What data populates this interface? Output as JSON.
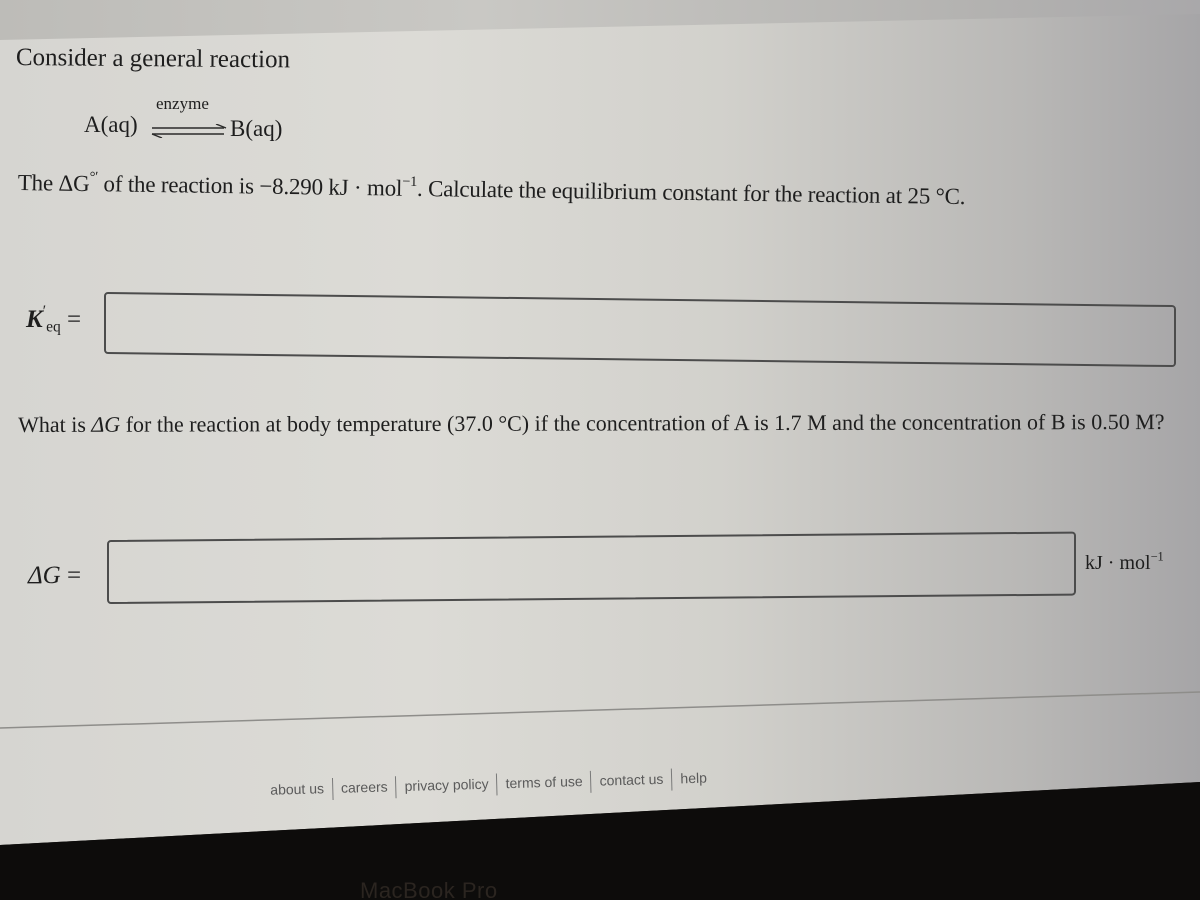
{
  "question": {
    "intro": "Consider a general reaction",
    "reaction": {
      "reactant": "A(aq)",
      "product": "B(aq)",
      "catalyst": "enzyme",
      "arrow": "equilibrium-arrow"
    },
    "part1": {
      "prompt_pre": "The ",
      "delta_g_symbol": "ΔG",
      "delta_g_super": "°′",
      "prompt_mid": " of the reaction is −8.290 kJ · mol",
      "exponent": "−1",
      "prompt_post": ". Calculate the equilibrium constant for the reaction at 25 °C.",
      "label_symbol": "K",
      "label_super": "′",
      "label_sub": "eq",
      "label_equals": " =",
      "answer_value": "",
      "answer_placeholder": ""
    },
    "part2": {
      "prompt_pre": "What is ",
      "delta_g_symbol": "ΔG",
      "prompt_post": " for the reaction at body temperature (37.0 °C) if the concentration of A is 1.7 M and the concentration of B is 0.50 M?",
      "label_symbol": "ΔG",
      "label_equals": " =",
      "answer_value": "",
      "answer_placeholder": "",
      "units_pre": "kJ · mol",
      "units_exponent": "−1"
    }
  },
  "footer": {
    "links": [
      "about us",
      "careers",
      "privacy policy",
      "terms of use",
      "contact us",
      "help"
    ]
  },
  "device": {
    "brand_label": "MacBook Pro"
  }
}
